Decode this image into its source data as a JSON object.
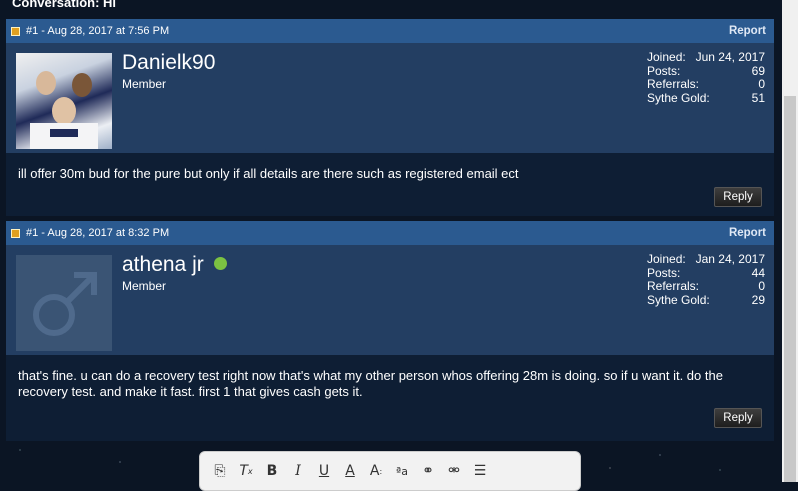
{
  "conversation_title": "Conversation: Hi",
  "posts": [
    {
      "header": "#1 - Aug 28, 2017 at 7:56 PM",
      "report_label": "Report",
      "username": "Danielk90",
      "usertitle": "Member",
      "online": false,
      "stats": [
        {
          "label": "Joined:",
          "value": "Jun 24, 2017"
        },
        {
          "label": "Posts:",
          "value": "69"
        },
        {
          "label": "Referrals:",
          "value": "0"
        },
        {
          "label": "Sythe Gold:",
          "value": "51"
        }
      ],
      "message": "ill offer 30m bud for the pure but only if all details are there such as registered email ect",
      "reply_label": "Reply"
    },
    {
      "header": "#1 - Aug 28, 2017 at 8:32 PM",
      "report_label": "Report",
      "username": "athena jr",
      "usertitle": "Member",
      "online": true,
      "stats": [
        {
          "label": "Joined:",
          "value": "Jan 24, 2017"
        },
        {
          "label": "Posts:",
          "value": "44"
        },
        {
          "label": "Referrals:",
          "value": "0"
        },
        {
          "label": "Sythe Gold:",
          "value": "29"
        }
      ],
      "message": "that's fine. u can do a recovery test right now that's what my other person whos offering 28m is doing. so if u want it. do the recovery test. and make it fast. first 1 that gives cash gets it.",
      "reply_label": "Reply"
    }
  ],
  "toolbar_icons": [
    "paint-format-icon",
    "remove-format-icon",
    "bold-icon",
    "italic-icon",
    "underline-icon",
    "text-color-icon",
    "font-size-icon",
    "font-family-icon",
    "link-icon",
    "unlink-icon",
    "align-icon"
  ],
  "colors": {
    "post_header": "#2b5a90",
    "user_area": "#233e62",
    "post_body": "#0e1e34",
    "online": "#7bc242"
  }
}
